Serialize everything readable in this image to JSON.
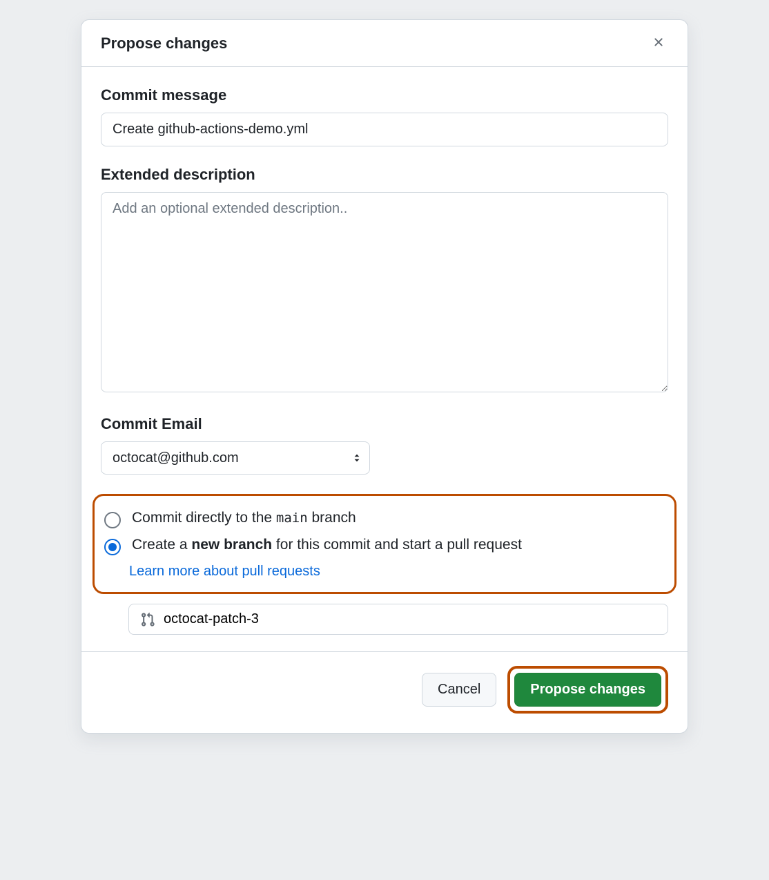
{
  "dialog": {
    "title": "Propose changes",
    "commit_message": {
      "label": "Commit message",
      "value": "Create github-actions-demo.yml"
    },
    "extended_description": {
      "label": "Extended description",
      "placeholder": "Add an optional extended description.."
    },
    "commit_email": {
      "label": "Commit Email",
      "selected": "octocat@github.com"
    },
    "branch_choice": {
      "direct": {
        "prefix": "Commit directly to the ",
        "branch_code": "main",
        "suffix": " branch",
        "checked": false
      },
      "new_branch": {
        "prefix": "Create a ",
        "bold": "new branch",
        "suffix": " for this commit and start a pull request",
        "checked": true,
        "learn_more": "Learn more about pull requests"
      }
    },
    "branch_name": {
      "value": "octocat-patch-3"
    },
    "footer": {
      "cancel": "Cancel",
      "submit": "Propose changes"
    }
  }
}
